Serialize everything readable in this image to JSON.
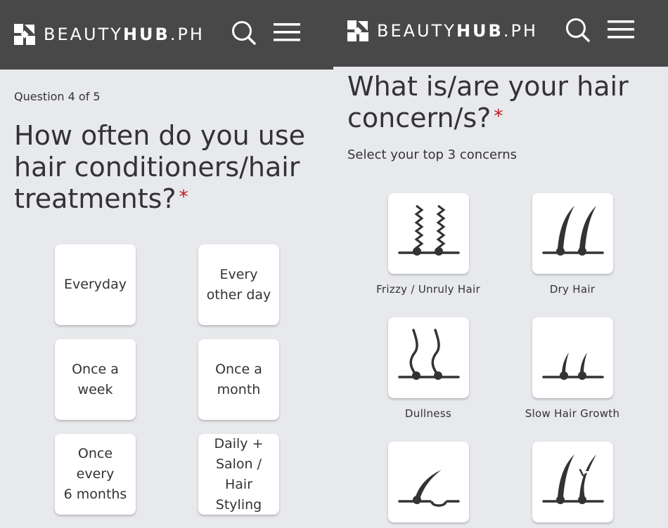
{
  "left_screen": {
    "header": {
      "logo_light": "BEAUTY",
      "logo_bold": "HUB",
      "logo_suffix": ".PH"
    },
    "question_counter": "Question 4 of 5",
    "question": "How often do you use hair conditioners/hair treatments?",
    "required_marker": "*",
    "options": [
      {
        "label": "Everyday"
      },
      {
        "label": "Every\nother day"
      },
      {
        "label": "Once a\nweek"
      },
      {
        "label": "Once a\nmonth"
      },
      {
        "label": "Once every\n6 months"
      },
      {
        "label": "Daily +\nSalon /\nHair Styling"
      }
    ]
  },
  "right_screen": {
    "header": {
      "logo_light": "BEAUTY",
      "logo_bold": "HUB",
      "logo_suffix": ".PH"
    },
    "question": "What is/are your hair concern/s?",
    "required_marker": "*",
    "subtitle": "Select your top 3 concerns",
    "concerns": [
      {
        "label": "Frizzy / Unruly Hair",
        "icon": "frizzy-hair-icon"
      },
      {
        "label": "Dry Hair",
        "icon": "dry-hair-icon"
      },
      {
        "label": "Dullness",
        "icon": "dull-hair-icon"
      },
      {
        "label": "Slow Hair Growth",
        "icon": "slow-growth-icon"
      },
      {
        "label": "",
        "icon": "thinning-hair-icon"
      },
      {
        "label": "",
        "icon": "split-ends-icon"
      }
    ]
  },
  "colors": {
    "header_bg": "#484848",
    "page_bg": "#e8e9ec",
    "required": "#c0161b",
    "icon": "#333333"
  }
}
